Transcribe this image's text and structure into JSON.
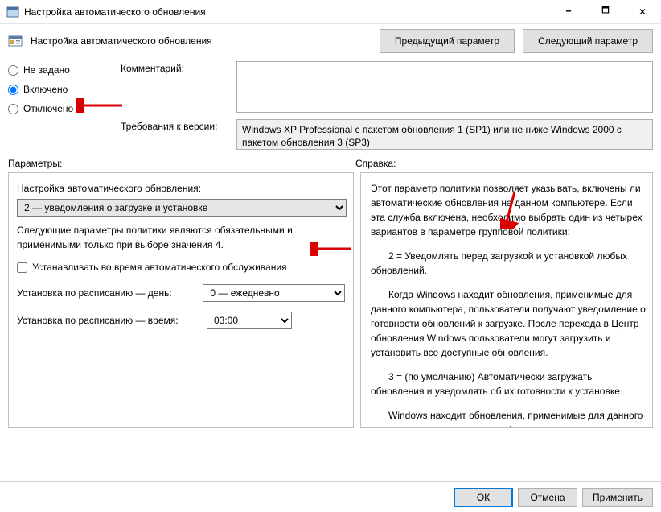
{
  "titlebar": {
    "title": "Настройка автоматического обновления"
  },
  "header": {
    "title": "Настройка автоматического обновления",
    "prev_btn": "Предыдущий параметр",
    "next_btn": "Следующий параметр"
  },
  "state": {
    "radio": {
      "not_configured": "Не задано",
      "enabled": "Включено",
      "disabled": "Отключено"
    },
    "comment_label": "Комментарий:",
    "comment_value": "",
    "req_label": "Требования к версии:",
    "req_value": "Windows XP Professional с пакетом обновления 1 (SP1) или не ниже Windows 2000 с пакетом обновления 3 (SP3)"
  },
  "sections": {
    "options": "Параметры:",
    "help": "Справка:"
  },
  "options": {
    "heading": "Настройка автоматического обновления:",
    "update_mode_value": "2 — уведомления о загрузке и установке",
    "note": "Следующие параметры политики являются обязательными и применимыми только при выборе значения 4.",
    "chk_label": "Устанавливать во время автоматического обслуживания",
    "day_label": "Установка по расписанию — день:",
    "day_value": "0 — ежедневно",
    "time_label": "Установка по расписанию — время:",
    "time_value": "03:00"
  },
  "help": {
    "p1": "Этот параметр политики позволяет указывать, включены ли автоматические обновления на данном компьютере. Если эта служба включена, необходимо выбрать один из четырех вариантов в параметре групповой политики:",
    "p2": "2 = Уведомлять перед загрузкой и установкой любых обновлений.",
    "p3": "Когда Windows находит обновления, применимые для данного компьютера, пользователи получают уведомление о готовности обновлений к загрузке. После перехода в Центр обновления Windows пользователи могут загрузить и установить все доступные обновления.",
    "p4": "3 =  (по умолчанию) Автоматически загружать обновления и уведомлять об их готовности к установке",
    "p5": "Windows находит обновления, применимые для данного компьютера, и загружает их в фоновом режиме (пользователь"
  },
  "footer": {
    "ok": "ОК",
    "cancel": "Отмена",
    "apply": "Применить"
  }
}
